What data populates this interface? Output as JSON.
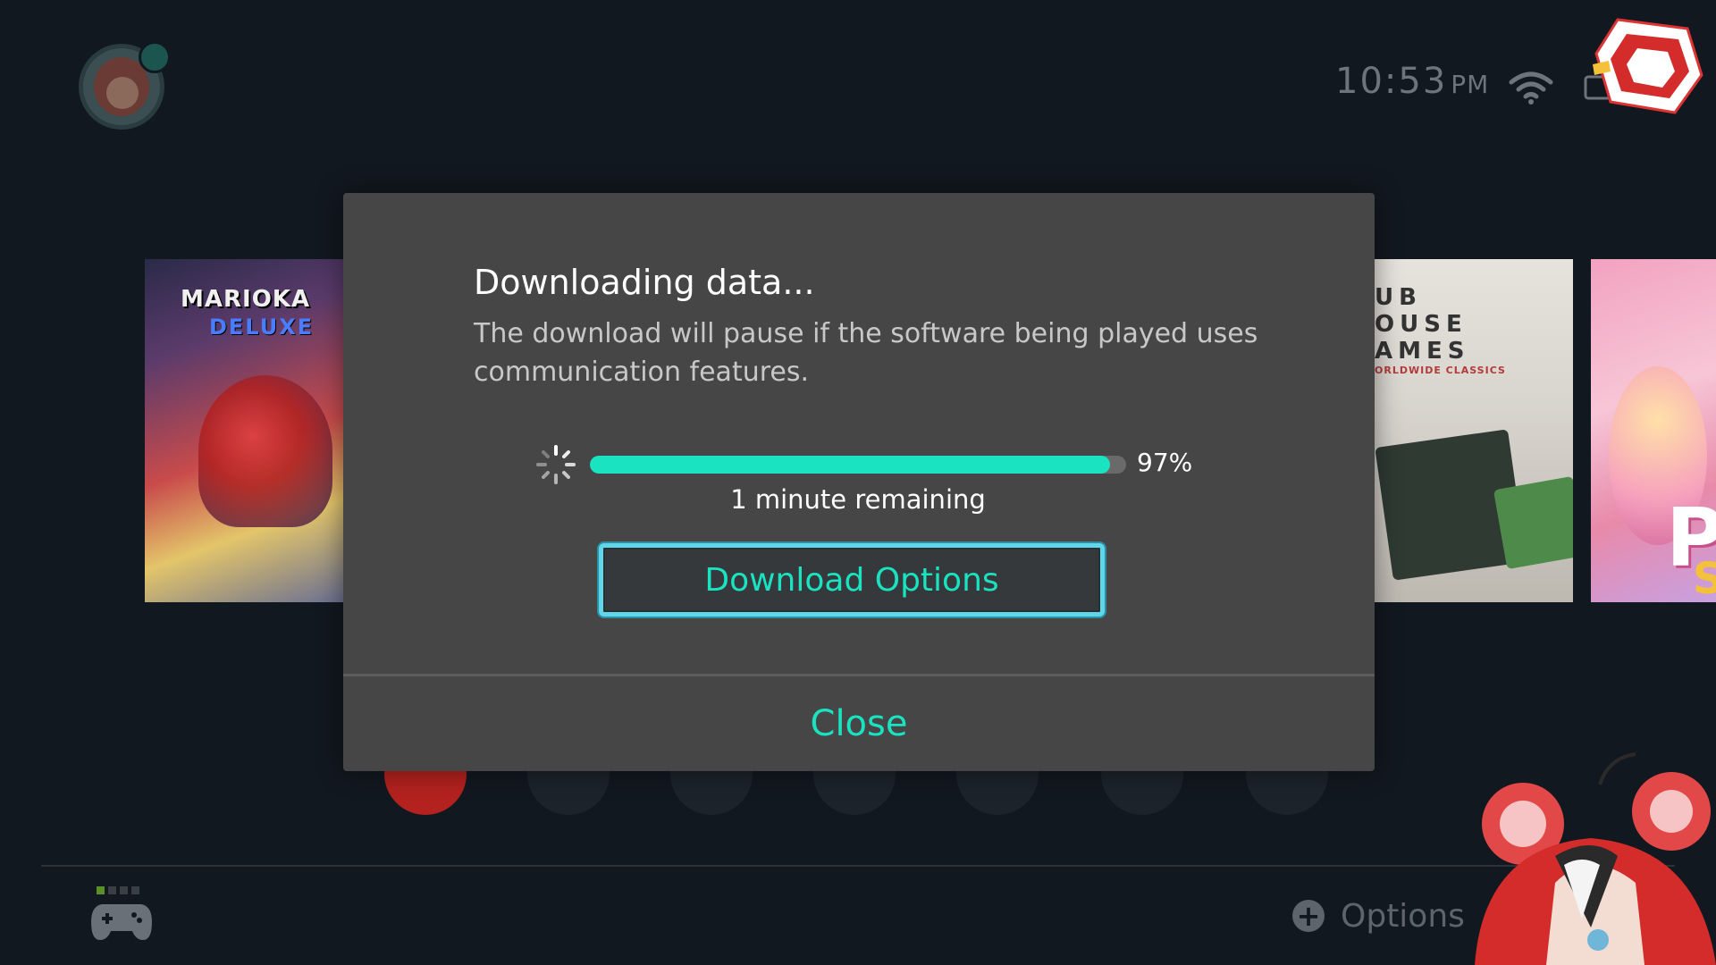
{
  "status_bar": {
    "time": "10:53",
    "ampm": "PM"
  },
  "game_tiles": [
    {
      "title_line1": "MARIOKA",
      "title_line2": "DELUXE"
    },
    {
      "title_lines": "UB\nOUSE\nAMES",
      "subtitle": "ORLDWIDE CLASSICS"
    },
    {
      "title_letters": "P",
      "subtitle_letters": "S"
    }
  ],
  "dialog": {
    "title": "Downloading data...",
    "body": "The download will pause if the software being played uses communication features.",
    "progress_percent_value": 97,
    "progress_percent_label": "97%",
    "time_remaining": "1 minute remaining",
    "download_options_label": "Download Options",
    "close_label": "Close"
  },
  "bottom_bar": {
    "options_label": "Options"
  },
  "colors": {
    "accent": "#19e3c0",
    "focus_border": "#5fd6ea",
    "dialog_bg": "#464646",
    "screen_bg": "#121820"
  },
  "icons": {
    "wifi": "wifi-icon",
    "battery": "battery-icon",
    "spinner": "loading-spinner-icon",
    "controller": "controller-icon",
    "plus": "plus-button-icon"
  }
}
